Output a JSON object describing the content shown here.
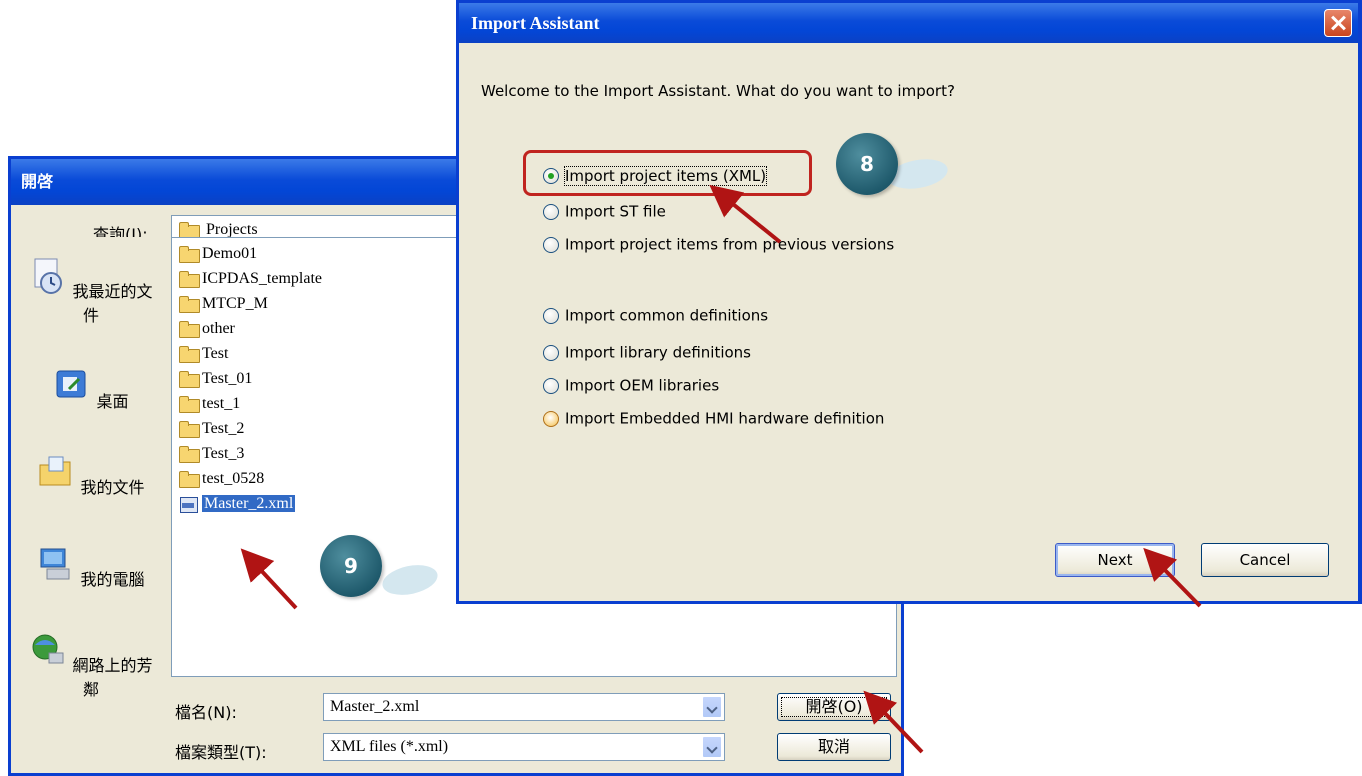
{
  "open_dialog": {
    "title": "開啓",
    "look_in_label": "查詢(I):",
    "look_in_value": "Projects",
    "places": [
      {
        "label": "我最近的文件",
        "icon": "recent-documents-icon"
      },
      {
        "label": "桌面",
        "icon": "desktop-icon"
      },
      {
        "label": "我的文件",
        "icon": "my-documents-icon"
      },
      {
        "label": "我的電腦",
        "icon": "my-computer-icon"
      },
      {
        "label": "網路上的芳鄰",
        "icon": "network-places-icon"
      }
    ],
    "files": [
      {
        "name": "Demo01",
        "type": "folder"
      },
      {
        "name": "ICPDAS_template",
        "type": "folder"
      },
      {
        "name": "MTCP_M",
        "type": "folder"
      },
      {
        "name": "other",
        "type": "folder"
      },
      {
        "name": "Test",
        "type": "folder"
      },
      {
        "name": "Test_01",
        "type": "folder"
      },
      {
        "name": "test_1",
        "type": "folder"
      },
      {
        "name": "Test_2",
        "type": "folder"
      },
      {
        "name": "Test_3",
        "type": "folder"
      },
      {
        "name": "test_0528",
        "type": "folder"
      },
      {
        "name": "Master_2.xml",
        "type": "xml",
        "selected": true
      }
    ],
    "filename_label": "檔名(N):",
    "filename_value": "Master_2.xml",
    "filetype_label": "檔案類型(T):",
    "filetype_value": "XML files (*.xml)",
    "open_button": "開啓(O)",
    "cancel_button": "取消"
  },
  "import_assistant": {
    "title": "Import Assistant",
    "prompt": "Welcome to the Import Assistant. What do you want to import?",
    "options_group1": [
      {
        "label": "Import project items (XML)",
        "checked": true
      },
      {
        "label": "Import ST file",
        "checked": false
      },
      {
        "label": "Import project items from previous versions",
        "checked": false
      }
    ],
    "options_group2": [
      {
        "label": "Import common definitions",
        "checked": false
      },
      {
        "label": "Import library definitions",
        "checked": false
      },
      {
        "label": "Import OEM libraries",
        "checked": false
      },
      {
        "label": "Import Embedded HMI hardware definition",
        "checked": false,
        "hover": true
      }
    ],
    "next_button": "Next",
    "cancel_button": "Cancel"
  },
  "callouts": {
    "step8": "8",
    "step9": "9"
  },
  "colors": {
    "titlebar": "#0a4bd8",
    "dialog_bg": "#ece9d8",
    "highlight": "#c0241f",
    "callout": "#1f5a6c",
    "selection": "#316ac5"
  }
}
